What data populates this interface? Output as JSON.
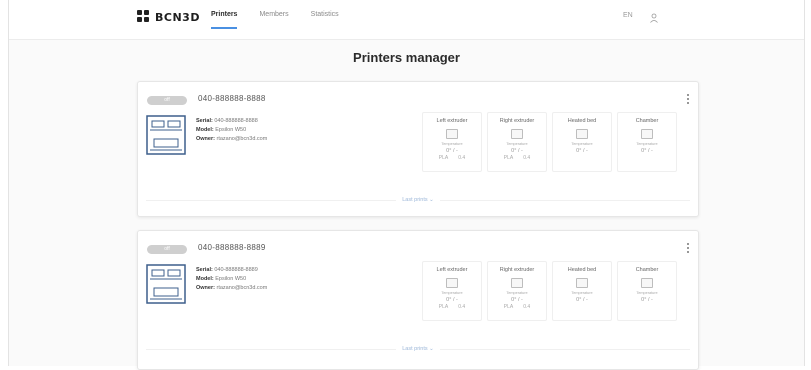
{
  "header": {
    "logo_text": "BCN3D",
    "nav": [
      {
        "label": "Printers",
        "active": true
      },
      {
        "label": "Members",
        "active": false
      },
      {
        "label": "Statistics",
        "active": false
      }
    ],
    "language": "EN",
    "accent_color": "#4a90e2"
  },
  "page": {
    "title": "Printers manager"
  },
  "printers": [
    {
      "status": "off",
      "id": "040-888888-8888",
      "serial_label": "Serial:",
      "serial": "040-888888-8888",
      "model_label": "Model:",
      "model": "Epsilon W50",
      "owner_label": "Owner:",
      "owner": "rtazano@bcn3d.com",
      "modules": [
        {
          "title": "Left extruder",
          "temp_label": "Temperature",
          "temp": "0° / -",
          "material": "PLA",
          "nozzle": "0.4"
        },
        {
          "title": "Right extruder",
          "temp_label": "Temperature",
          "temp": "0° / -",
          "material": "PLA",
          "nozzle": "0.4"
        },
        {
          "title": "Heated bed",
          "temp_label": "Temperature",
          "temp": "0° / -"
        },
        {
          "title": "Chamber",
          "temp_label": "Temperature",
          "temp": "0° / -"
        }
      ],
      "last_prints": "Last prints ⌄"
    },
    {
      "status": "off",
      "id": "040-888888-8889",
      "serial_label": "Serial:",
      "serial": "040-888888-8889",
      "model_label": "Model:",
      "model": "Epsilon W50",
      "owner_label": "Owner:",
      "owner": "rtazano@bcn3d.com",
      "modules": [
        {
          "title": "Left extruder",
          "temp_label": "Temperature",
          "temp": "0° / -",
          "material": "PLA",
          "nozzle": "0.4"
        },
        {
          "title": "Right extruder",
          "temp_label": "Temperature",
          "temp": "0° / -",
          "material": "PLA",
          "nozzle": "0.4"
        },
        {
          "title": "Heated bed",
          "temp_label": "Temperature",
          "temp": "0° / -"
        },
        {
          "title": "Chamber",
          "temp_label": "Temperature",
          "temp": "0° / -"
        }
      ],
      "last_prints": "Last prints ⌄"
    }
  ]
}
